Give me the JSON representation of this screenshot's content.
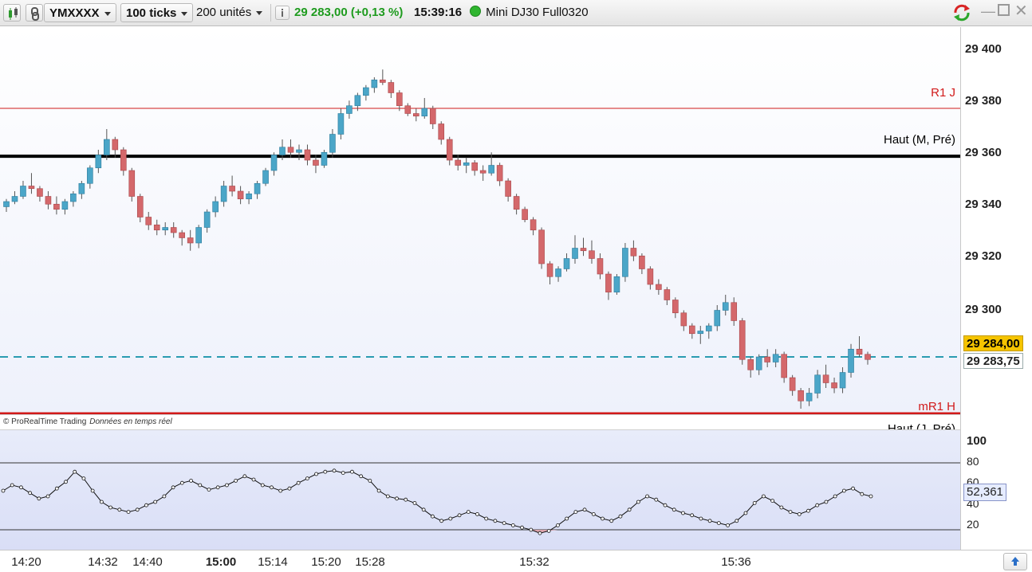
{
  "toolbar": {
    "symbol": "YMXXXX",
    "ticks": "100 ticks",
    "units": "200 unités",
    "price_change": "29 283,00 (+0,13 %)",
    "time": "15:39:16",
    "feed": "Mini DJ30 Full0320",
    "icons": [
      "chart-type-icon",
      "link-icon",
      "info-icon",
      "refresh-icon",
      "minimize-icon",
      "maximize-icon",
      "close-icon"
    ]
  },
  "colors": {
    "up_candle": "#4ba6c8",
    "down_candle": "#d4686b",
    "price_change": "#1e9b1e",
    "resistance": "#d11a1a",
    "pivot_line": "#000000",
    "current_price_line": "#2a9bb0",
    "current_box": "#f5c400"
  },
  "price_axis": {
    "ticks": [
      "29 400",
      "29 380",
      "29 360",
      "29 340",
      "29 320",
      "29 300"
    ],
    "current_price": "29 284,00",
    "last_price": "29 283,75"
  },
  "levels": {
    "r1j": "R1 J",
    "haut_m_pre": "Haut (M, Pré)",
    "mr1h": "mR1 H",
    "haut_j_pre": "Haut (J, Pré)"
  },
  "credit": {
    "brand": "© ProRealTime Trading",
    "note": "Données en temps réel"
  },
  "oscillator": {
    "ticks": [
      "100",
      "80",
      "60",
      "40",
      "20"
    ],
    "value": "52,361",
    "upper": 80,
    "lower": 20
  },
  "time_axis": {
    "labels": [
      "14:20",
      "14:32",
      "14:40",
      "15:00",
      "15:14",
      "15:20",
      "15:28",
      "15:32",
      "15:36"
    ],
    "bold": "15:00"
  },
  "chart_data": {
    "type": "candlestick",
    "price_range": [
      29264,
      29406
    ],
    "candles": [
      [
        29342,
        29345,
        29340,
        29344
      ],
      [
        29344,
        29348,
        29343,
        29346
      ],
      [
        29346,
        29352,
        29345,
        29350
      ],
      [
        29350,
        29355,
        29347,
        29349
      ],
      [
        29349,
        29350,
        29344,
        29346
      ],
      [
        29346,
        29348,
        29341,
        29343
      ],
      [
        29343,
        29346,
        29339,
        29341
      ],
      [
        29341,
        29345,
        29339,
        29344
      ],
      [
        29344,
        29348,
        29342,
        29347
      ],
      [
        29347,
        29352,
        29345,
        29351
      ],
      [
        29351,
        29358,
        29349,
        29357
      ],
      [
        29357,
        29364,
        29355,
        29362
      ],
      [
        29362,
        29372,
        29360,
        29368
      ],
      [
        29368,
        29369,
        29361,
        29364
      ],
      [
        29364,
        29365,
        29354,
        29356
      ],
      [
        29356,
        29357,
        29344,
        29346
      ],
      [
        29346,
        29347,
        29336,
        29338
      ],
      [
        29338,
        29340,
        29333,
        29335
      ],
      [
        29335,
        29337,
        29331,
        29333
      ],
      [
        29333,
        29336,
        29331,
        29334
      ],
      [
        29334,
        29336,
        29330,
        29332
      ],
      [
        29332,
        29333,
        29327,
        29330
      ],
      [
        29330,
        29333,
        29325,
        29328
      ],
      [
        29328,
        29335,
        29326,
        29334
      ],
      [
        29334,
        29341,
        29332,
        29340
      ],
      [
        29340,
        29346,
        29338,
        29344
      ],
      [
        29344,
        29352,
        29342,
        29350
      ],
      [
        29350,
        29354,
        29346,
        29348
      ],
      [
        29348,
        29350,
        29343,
        29345
      ],
      [
        29345,
        29348,
        29343,
        29347
      ],
      [
        29347,
        29352,
        29345,
        29351
      ],
      [
        29351,
        29357,
        29350,
        29356
      ],
      [
        29356,
        29363,
        29354,
        29362
      ],
      [
        29362,
        29368,
        29360,
        29365
      ],
      [
        29365,
        29368,
        29361,
        29363
      ],
      [
        29363,
        29366,
        29360,
        29364
      ],
      [
        29364,
        29366,
        29358,
        29360
      ],
      [
        29360,
        29362,
        29355,
        29358
      ],
      [
        29358,
        29364,
        29357,
        29363
      ],
      [
        29363,
        29372,
        29361,
        29370
      ],
      [
        29370,
        29380,
        29368,
        29378
      ],
      [
        29378,
        29383,
        29376,
        29381
      ],
      [
        29381,
        29386,
        29379,
        29385
      ],
      [
        29385,
        29389,
        29383,
        29388
      ],
      [
        29388,
        29392,
        29386,
        29391
      ],
      [
        29391,
        29395,
        29389,
        29390
      ],
      [
        29390,
        29391,
        29384,
        29386
      ],
      [
        29386,
        29387,
        29379,
        29381
      ],
      [
        29381,
        29382,
        29377,
        29378
      ],
      [
        29378,
        29380,
        29375,
        29377
      ],
      [
        29377,
        29384,
        29376,
        29380
      ],
      [
        29380,
        29381,
        29372,
        29374
      ],
      [
        29374,
        29375,
        29366,
        29368
      ],
      [
        29368,
        29369,
        29358,
        29360
      ],
      [
        29360,
        29362,
        29356,
        29358
      ],
      [
        29358,
        29361,
        29355,
        29359
      ],
      [
        29359,
        29360,
        29354,
        29356
      ],
      [
        29356,
        29358,
        29352,
        29355
      ],
      [
        29355,
        29363,
        29354,
        29358
      ],
      [
        29358,
        29359,
        29350,
        29352
      ],
      [
        29352,
        29353,
        29344,
        29346
      ],
      [
        29346,
        29347,
        29339,
        29341
      ],
      [
        29341,
        29342,
        29336,
        29337
      ],
      [
        29337,
        29338,
        29331,
        29333
      ],
      [
        29333,
        29334,
        29318,
        29320
      ],
      [
        29320,
        29321,
        29312,
        29315
      ],
      [
        29315,
        29319,
        29313,
        29318
      ],
      [
        29318,
        29324,
        29317,
        29322
      ],
      [
        29322,
        29331,
        29320,
        29326
      ],
      [
        29326,
        29330,
        29323,
        29325
      ],
      [
        29325,
        29329,
        29320,
        29322
      ],
      [
        29322,
        29324,
        29314,
        29316
      ],
      [
        29316,
        29317,
        29306,
        29309
      ],
      [
        29309,
        29316,
        29308,
        29315
      ],
      [
        29315,
        29328,
        29313,
        29326
      ],
      [
        29326,
        29329,
        29321,
        29323
      ],
      [
        29323,
        29324,
        29316,
        29318
      ],
      [
        29318,
        29319,
        29310,
        29312
      ],
      [
        29312,
        29314,
        29308,
        29310
      ],
      [
        29310,
        29311,
        29304,
        29306
      ],
      [
        29306,
        29307,
        29299,
        29301
      ],
      [
        29301,
        29302,
        29294,
        29296
      ],
      [
        29296,
        29297,
        29291,
        29293
      ],
      [
        29293,
        29296,
        29289,
        29294
      ],
      [
        29294,
        29297,
        29291,
        29296
      ],
      [
        29296,
        29304,
        29294,
        29302
      ],
      [
        29302,
        29308,
        29300,
        29305
      ],
      [
        29305,
        29307,
        29296,
        29298
      ],
      [
        29298,
        29299,
        29281,
        29283
      ],
      [
        29283,
        29284,
        29276,
        29279
      ],
      [
        29279,
        29285,
        29277,
        29284
      ],
      [
        29284,
        29287,
        29280,
        29282
      ],
      [
        29282,
        29287,
        29280,
        29285
      ],
      [
        29285,
        29286,
        29274,
        29276
      ],
      [
        29276,
        29277,
        29269,
        29271
      ],
      [
        29271,
        29272,
        29264,
        29267
      ],
      [
        29267,
        29272,
        29265,
        29270
      ],
      [
        29270,
        29279,
        29268,
        29277
      ],
      [
        29277,
        29281,
        29272,
        29274
      ],
      [
        29274,
        29276,
        29270,
        29272
      ],
      [
        29272,
        29280,
        29270,
        29278
      ],
      [
        29278,
        29289,
        29276,
        29287
      ],
      [
        29287,
        29292,
        29284,
        29285
      ],
      [
        29285,
        29286,
        29281,
        29283
      ]
    ],
    "oscillator_values": [
      55,
      60,
      58,
      53,
      48,
      50,
      57,
      63,
      72,
      66,
      55,
      45,
      40,
      38,
      36,
      38,
      42,
      45,
      50,
      58,
      62,
      64,
      60,
      56,
      58,
      60,
      64,
      68,
      65,
      60,
      58,
      55,
      57,
      62,
      66,
      70,
      72,
      73,
      71,
      72,
      68,
      64,
      55,
      50,
      48,
      47,
      44,
      38,
      32,
      28,
      30,
      33,
      36,
      34,
      30,
      28,
      26,
      24,
      22,
      20,
      17,
      19,
      24,
      30,
      36,
      38,
      34,
      30,
      28,
      32,
      38,
      45,
      50,
      47,
      42,
      38,
      35,
      33,
      30,
      28,
      26,
      24,
      28,
      35,
      44,
      50,
      46,
      40,
      36,
      34,
      37,
      42,
      45,
      50,
      55,
      57,
      52,
      50
    ]
  }
}
